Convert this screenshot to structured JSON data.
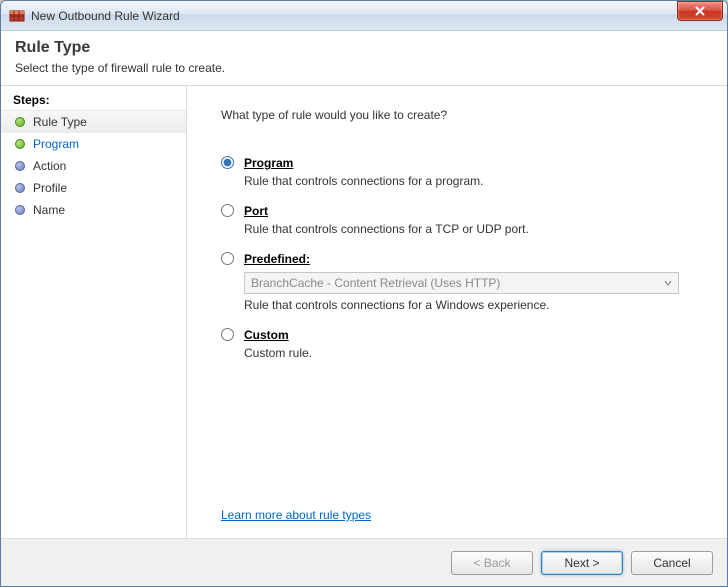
{
  "window": {
    "title": "New Outbound Rule Wizard"
  },
  "header": {
    "title": "Rule Type",
    "subtitle": "Select the type of firewall rule to create."
  },
  "sidebar": {
    "steps_label": "Steps:",
    "items": [
      {
        "label": "Rule Type",
        "state": "current"
      },
      {
        "label": "Program",
        "state": "link"
      },
      {
        "label": "Action",
        "state": "future"
      },
      {
        "label": "Profile",
        "state": "future"
      },
      {
        "label": "Name",
        "state": "future"
      }
    ]
  },
  "content": {
    "question": "What type of rule would you like to create?",
    "options": [
      {
        "key": "program",
        "title": "Program",
        "desc": "Rule that controls connections for a program.",
        "selected": true
      },
      {
        "key": "port",
        "title": "Port",
        "desc": "Rule that controls connections for a TCP or UDP port.",
        "selected": false
      },
      {
        "key": "predefined",
        "title": "Predefined:",
        "desc": "Rule that controls connections for a Windows experience.",
        "selected": false,
        "dropdown_value": "BranchCache - Content Retrieval (Uses HTTP)"
      },
      {
        "key": "custom",
        "title": "Custom",
        "desc": "Custom rule.",
        "selected": false
      }
    ],
    "learn_link": "Learn more about rule types"
  },
  "footer": {
    "back": "< Back",
    "next": "Next >",
    "cancel": "Cancel"
  }
}
